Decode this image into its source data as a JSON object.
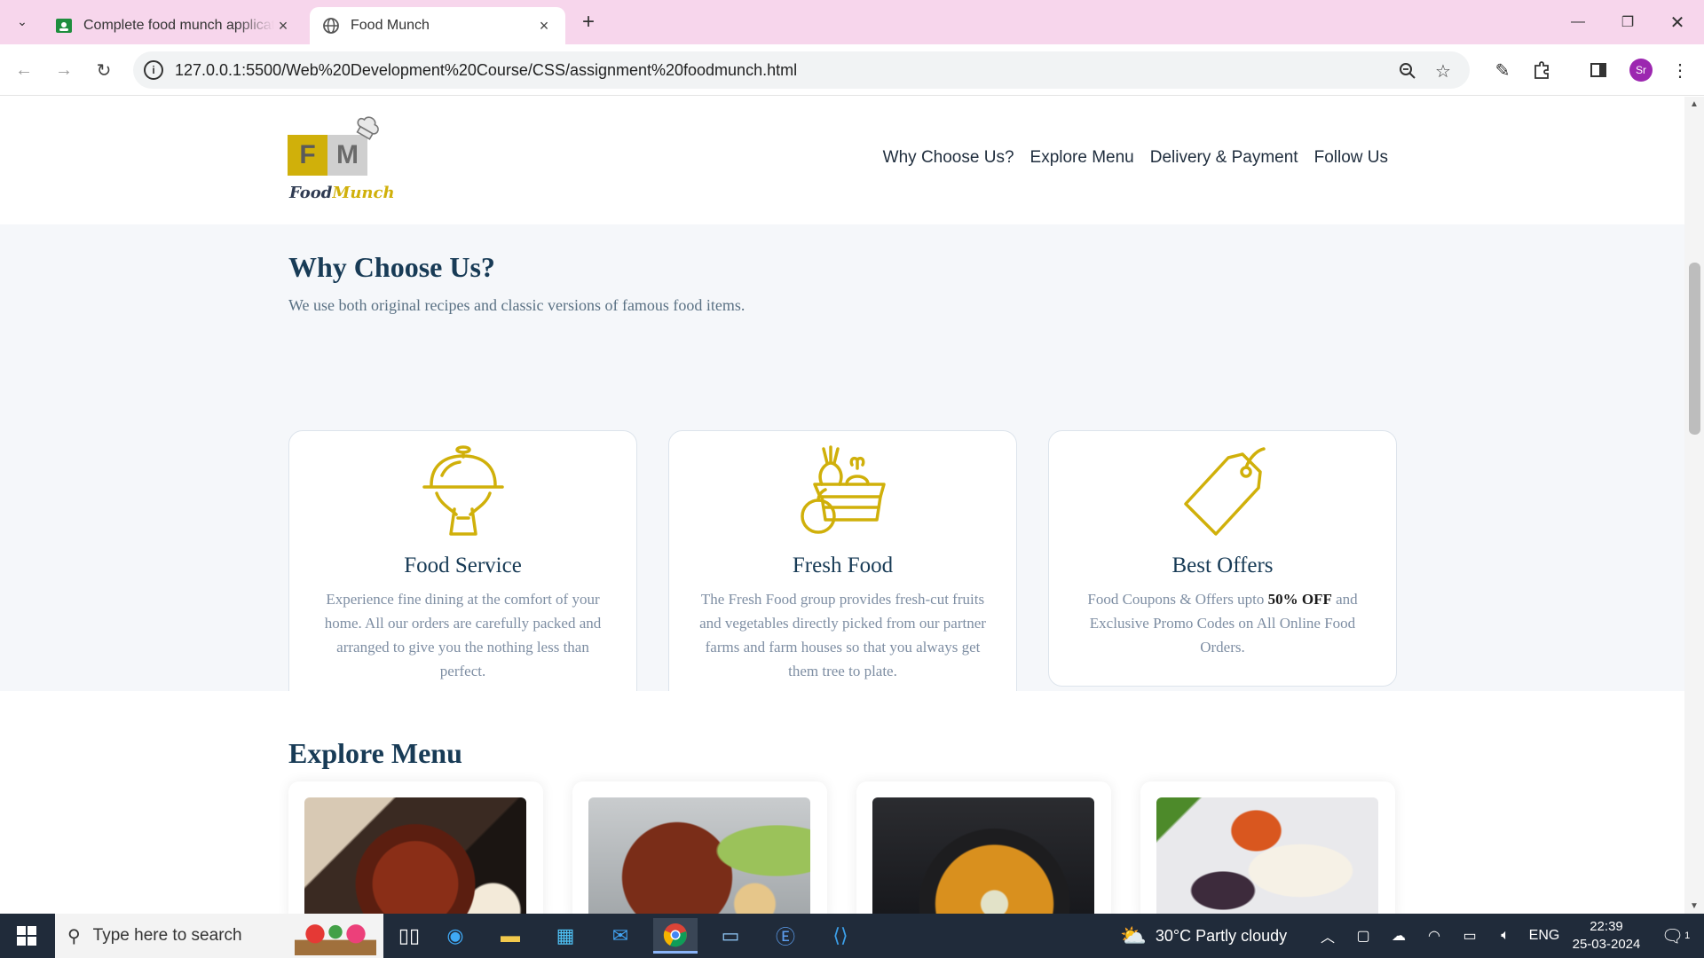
{
  "browser": {
    "tabs": [
      {
        "title": "Complete food munch application",
        "icon": "google-classroom-icon",
        "active": false
      },
      {
        "title": "Food Munch",
        "icon": "globe-icon",
        "active": true
      }
    ],
    "new_tab_symbol": "+",
    "url": "127.0.0.1:5500/Web%20Development%20Course/CSS/assignment%20foodmunch.html",
    "profile_initials": "Sr"
  },
  "site": {
    "logo_letters": [
      "F",
      "M"
    ],
    "logo_brand_food": "Food",
    "logo_brand_munch": "Munch",
    "nav": [
      "Why Choose Us?",
      "Explore Menu",
      "Delivery & Payment",
      "Follow Us"
    ],
    "why": {
      "title": "Why Choose Us?",
      "description": "We use both original recipes and classic versions of famous food items.",
      "cards": [
        {
          "icon": "food-service-cloche-icon",
          "title": "Food Service",
          "description": "Experience fine dining at the comfort of your home. All our orders are carefully packed and arranged to give you the nothing less than perfect."
        },
        {
          "icon": "fresh-food-basket-icon",
          "title": "Fresh Food",
          "description": "The Fresh Food group provides fresh-cut fruits and vegetables directly picked from our partner farms and farm houses so that you always get them tree to plate."
        },
        {
          "icon": "price-tag-icon",
          "title": "Best Offers",
          "description_before": "Food Coupons & Offers upto ",
          "description_bold": "50% OFF",
          "description_after": " and Exclusive Promo Codes on All Online Food Orders."
        }
      ]
    },
    "explore": {
      "title": "Explore Menu",
      "items": [
        {
          "image": "fried-chicken-photo"
        },
        {
          "image": "salad-bowl-photo"
        },
        {
          "image": "soup-bowl-photo"
        },
        {
          "image": "seafood-platter-photo"
        }
      ]
    }
  },
  "colors": {
    "accent": "#d0b00a",
    "heading": "#183b56",
    "text_muted": "#7e8ea3",
    "section_bg": "#f5f7fa",
    "tabbar_bg": "#f7d6ec",
    "taskbar_bg": "#202b3a"
  },
  "taskbar": {
    "search_placeholder": "Type here to search",
    "weather": "30°C  Partly cloudy",
    "language": "ENG",
    "time": "22:39",
    "date": "25-03-2024",
    "notification_count": "1"
  }
}
